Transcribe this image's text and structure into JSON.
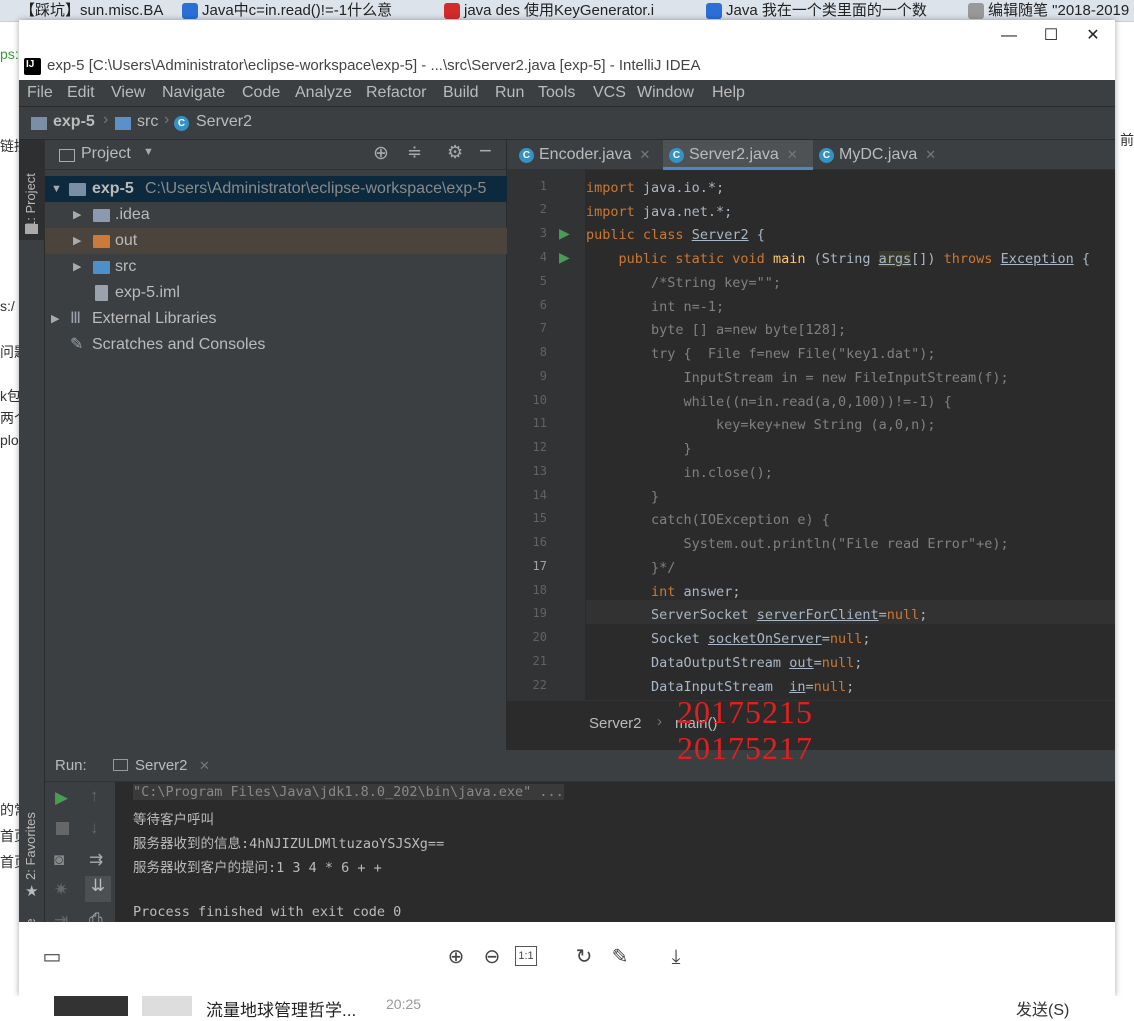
{
  "browser": {
    "tabs": [
      {
        "label": "【踩坑】sun.misc.BASE",
        "color": "#f5f5f5"
      },
      {
        "label": "Java中c=in.read()!=-1什么意",
        "color": "#2b6fd6"
      },
      {
        "label": "java des 使用KeyGenerator.i",
        "color": "#d22b2b"
      },
      {
        "label": "Java 我在一个类里面的一个数",
        "color": "#2b6fd6"
      },
      {
        "label": "编辑随笔 \"2018-2019",
        "color": "#888888"
      }
    ],
    "left_fragments": [
      "ps:/",
      "链接",
      "s:/",
      "问题",
      "k包",
      "两个",
      "plo",
      "的常",
      "首页",
      "首页"
    ],
    "right_fragment": "前",
    "bottom_chat": {
      "title": "流量地球管理哲学...",
      "time": "20:25",
      "send": "发送(S)"
    }
  },
  "window": {
    "title": "exp-5 [C:\\Users\\Administrator\\eclipse-workspace\\exp-5] - ...\\src\\Server2.java [exp-5] - IntelliJ IDEA",
    "minimize": "—",
    "maximize": "☐",
    "close": "✕"
  },
  "menu": [
    "File",
    "Edit",
    "View",
    "Navigate",
    "Code",
    "Analyze",
    "Refactor",
    "Build",
    "Run",
    "Tools",
    "VCS",
    "Window",
    "Help"
  ],
  "breadcrumb": [
    "exp-5",
    "src",
    "Server2"
  ],
  "sidebar": {
    "project_tab": "1: Project",
    "favorites_tab": "2: Favorites",
    "structure_tab": "re"
  },
  "project": {
    "header": "Project",
    "root": {
      "name": "exp-5",
      "path": "C:\\Users\\Administrator\\eclipse-workspace\\exp-5"
    },
    "children": [
      ".idea",
      "out",
      "src",
      "exp-5.iml"
    ],
    "external": "External Libraries",
    "scratches": "Scratches and Consoles"
  },
  "editor": {
    "tabs": [
      "Encoder.java",
      "Server2.java",
      "MyDC.java"
    ],
    "active_tab": 1,
    "line_numbers": [
      "1",
      "2",
      "3",
      "4",
      "5",
      "6",
      "7",
      "8",
      "9",
      "10",
      "11",
      "12",
      "13",
      "14",
      "15",
      "16",
      "17",
      "18",
      "19",
      "20",
      "21",
      "22"
    ],
    "breadcrumb": [
      "Server2",
      "main()"
    ]
  },
  "watermark": [
    "20175215",
    "20175217"
  ],
  "run": {
    "label": "Run:",
    "tab": "Server2",
    "output": [
      "\"C:\\Program Files\\Java\\jdk1.8.0_202\\bin\\java.exe\" ...",
      "等待客户呼叫",
      "服务器收到的信息:4hNJIZULDMltuzaoYSJSXg==",
      "服务器收到客户的提问:1 3 4 * 6 + +",
      "",
      "Process finished with exit code 0"
    ]
  },
  "viewer_toolbar": {
    "zoom_label": "1:1"
  }
}
